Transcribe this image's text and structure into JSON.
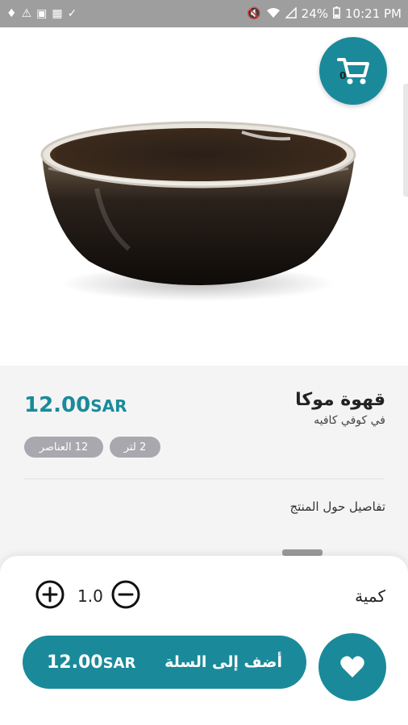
{
  "status_bar": {
    "battery": "24%",
    "time": "10:21 PM",
    "left_icons": [
      "tag-icon",
      "warning-icon",
      "sim-icon",
      "image-icon",
      "check-circle-icon"
    ],
    "right_icons": [
      "mute-icon",
      "wifi-icon",
      "signal-icon",
      "battery-icon"
    ]
  },
  "cart": {
    "count": "0",
    "icon": "shopping-cart-icon"
  },
  "product": {
    "name": "قهوة موكا",
    "cafe": "في كوفي كافيه",
    "price_value": "12.00",
    "currency": "SAR",
    "chips": {
      "size": "2 لتر",
      "items": "12 العناصر"
    },
    "details_heading": "تفاصيل حول المنتج"
  },
  "quantity": {
    "label": "كمية",
    "value": "1.0"
  },
  "actions": {
    "add_to_cart": "أضف إلى السلة",
    "price_value": "12.00",
    "currency": "SAR",
    "favorite_icon": "heart-icon"
  },
  "colors": {
    "accent": "#1a8a9a",
    "chip": "#a8a8ae",
    "status_bar": "#9e9e9e"
  }
}
